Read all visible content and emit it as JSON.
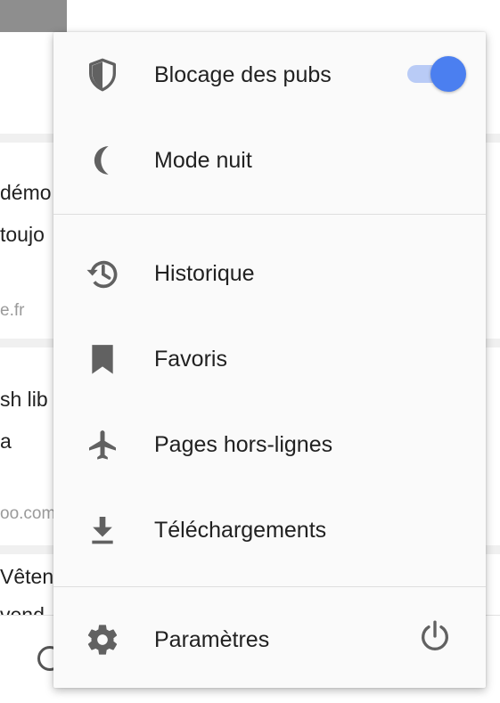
{
  "background": {
    "card1": {
      "line1": "démo",
      "line2": "toujo",
      "url": "e.fr"
    },
    "card2": {
      "line1": "sh lib",
      "line2": "a",
      "url": "oo.com"
    },
    "card3": {
      "line1": "Vêten",
      "line2": "vend"
    }
  },
  "menu": {
    "items": [
      {
        "label": "Blocage des pubs",
        "icon": "shield-icon",
        "toggle_on": true
      },
      {
        "label": "Mode nuit",
        "icon": "moon-icon"
      },
      {
        "label": "Historique",
        "icon": "history-icon"
      },
      {
        "label": "Favoris",
        "icon": "bookmark-icon"
      },
      {
        "label": "Pages hors-lignes",
        "icon": "airplane-icon"
      },
      {
        "label": "Téléchargements",
        "icon": "download-icon"
      },
      {
        "label": "Paramètres",
        "icon": "gear-icon",
        "secondary_icon": "power-icon"
      }
    ]
  },
  "colors": {
    "accent": "#4b7ff0",
    "icon": "#616161",
    "text": "#212121"
  }
}
